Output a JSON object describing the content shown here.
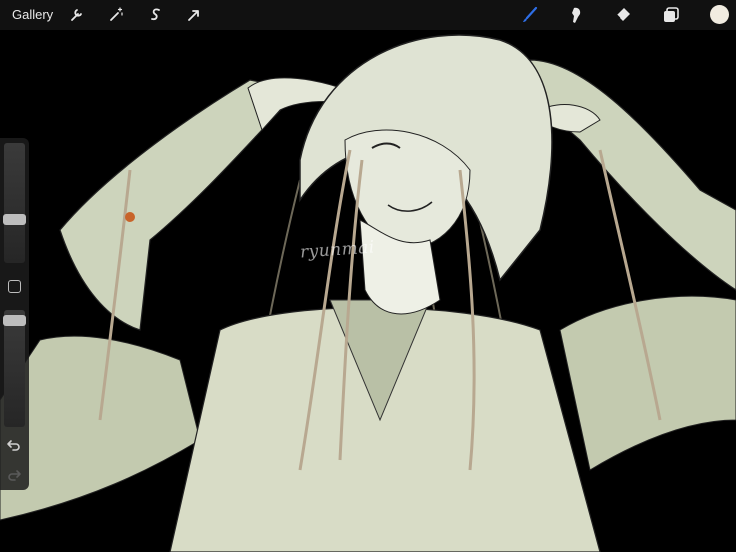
{
  "toolbar": {
    "gallery_label": "Gallery",
    "left_tools": [
      "wrench-icon",
      "magic-wand-icon",
      "selection-s-icon",
      "move-arrow-icon"
    ],
    "right_tools": [
      "brush-icon",
      "smudge-icon",
      "eraser-icon",
      "layers-icon"
    ],
    "active_tool": "brush-icon",
    "accent_color": "#2e6ee6",
    "current_color": "#f1ece1"
  },
  "sidebar": {
    "brush_size": 0.35,
    "opacity": 0.95,
    "icons": [
      "modify-square-icon",
      "undo-icon",
      "redo-icon"
    ]
  },
  "canvas": {
    "watermark": "ryunmai",
    "palette": [
      "#000000",
      "#d9dfc8",
      "#b8a890",
      "#4a5248"
    ]
  }
}
